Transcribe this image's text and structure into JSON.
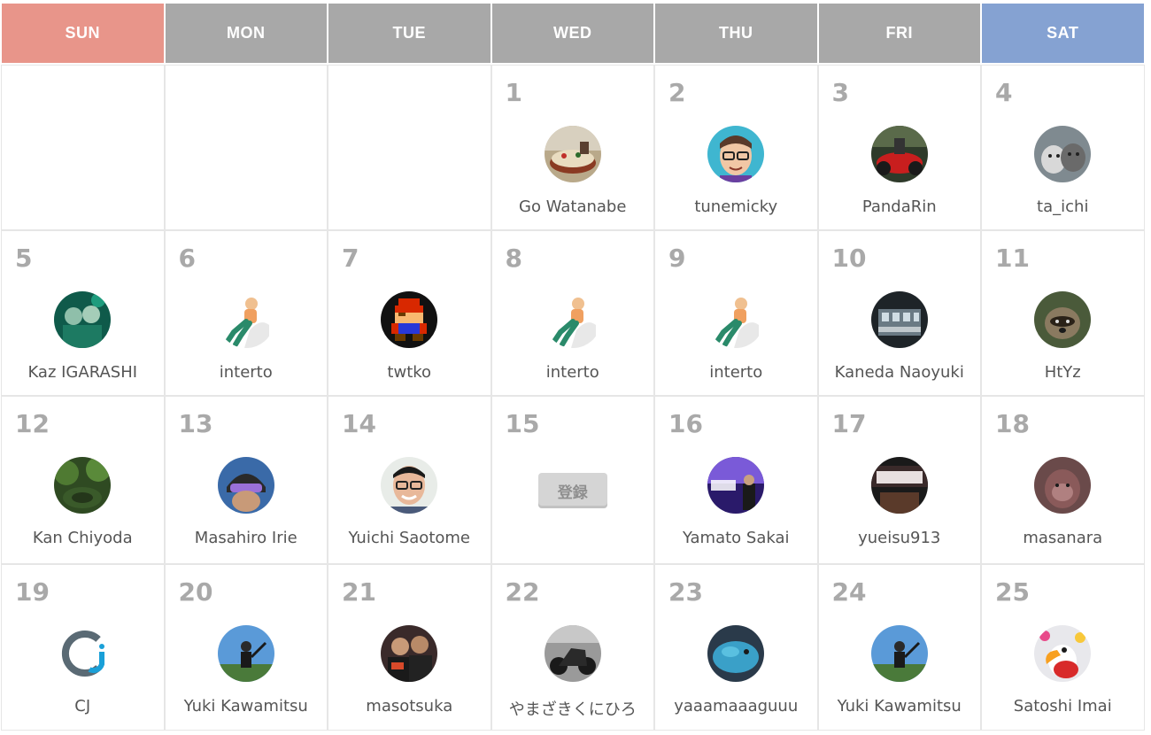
{
  "weekdays": [
    "SUN",
    "MON",
    "TUE",
    "WED",
    "THU",
    "FRI",
    "SAT"
  ],
  "colors": {
    "sun_header": "#e8958a",
    "sat_header": "#85a2d2",
    "weekday_header": "#a8a8a8",
    "day_number": "#a9a9a9",
    "name": "#555555"
  },
  "register_label": "登録",
  "weeks": [
    [
      {
        "day": null
      },
      {
        "day": null
      },
      {
        "day": null
      },
      {
        "day": "1",
        "name": "Go Watanabe",
        "avatar": "cake-photo"
      },
      {
        "day": "2",
        "name": "tunemicky",
        "avatar": "cartoon-face"
      },
      {
        "day": "3",
        "name": "PandaRin",
        "avatar": "red-motorcycle"
      },
      {
        "day": "4",
        "name": "ta_ichi",
        "avatar": "cats"
      }
    ],
    [
      {
        "day": "5",
        "name": "Kaz IGARASHI",
        "avatar": "people-green"
      },
      {
        "day": "6",
        "name": "interto",
        "avatar": "sitting-figure"
      },
      {
        "day": "7",
        "name": "twtko",
        "avatar": "pixel-mario"
      },
      {
        "day": "8",
        "name": "interto",
        "avatar": "sitting-figure"
      },
      {
        "day": "9",
        "name": "interto",
        "avatar": "sitting-figure"
      },
      {
        "day": "10",
        "name": "Kaneda Naoyuki",
        "avatar": "building-dark"
      },
      {
        "day": "11",
        "name": "HtYz",
        "avatar": "raccoon-dog"
      }
    ],
    [
      {
        "day": "12",
        "name": "Kan Chiyoda",
        "avatar": "forest"
      },
      {
        "day": "13",
        "name": "Masahiro Irie",
        "avatar": "helmet-person"
      },
      {
        "day": "14",
        "name": "Yuichi Saotome",
        "avatar": "smiling-man"
      },
      {
        "day": "15",
        "register": true
      },
      {
        "day": "16",
        "name": "Yamato Sakai",
        "avatar": "stage-purple"
      },
      {
        "day": "17",
        "name": "yueisu913",
        "avatar": "stage-world"
      },
      {
        "day": "18",
        "name": "masanara",
        "avatar": "monkey"
      }
    ],
    [
      {
        "day": "19",
        "name": "CJ",
        "avatar": "cj-logo"
      },
      {
        "day": "20",
        "name": "Yuki Kawamitsu",
        "avatar": "person-sky"
      },
      {
        "day": "21",
        "name": "masotsuka",
        "avatar": "two-men"
      },
      {
        "day": "22",
        "name": "やまざきくにひろ",
        "avatar": "motorcycle-dark"
      },
      {
        "day": "23",
        "name": "yaaamaaaguuu",
        "avatar": "blue-plush"
      },
      {
        "day": "24",
        "name": "Yuki Kawamitsu",
        "avatar": "person-sky"
      },
      {
        "day": "25",
        "name": "Satoshi Imai",
        "avatar": "toucan"
      }
    ]
  ]
}
